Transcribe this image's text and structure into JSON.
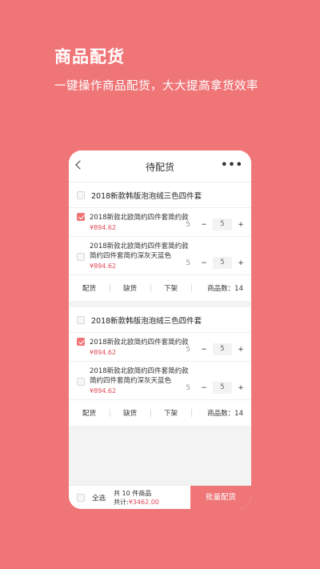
{
  "promo": {
    "title": "商品配货",
    "subtitle": "一键操作商品配货，大大提高拿货效率"
  },
  "nav": {
    "title": "待配货",
    "more": "•••"
  },
  "groups": [
    {
      "title": "2018新款韩版泡泡绒三色四件套",
      "items": [
        {
          "name": "2018新款北欧简约四件套简约款",
          "price": "¥894.62",
          "stock": "5",
          "qty": "5",
          "checked": true
        },
        {
          "name": "2018新款北欧简约四件套简约款简约四件套简约深灰天蓝色",
          "price": "¥894.62",
          "stock": "5",
          "qty": "5",
          "checked": false
        }
      ],
      "actions": {
        "pick": "配货",
        "short": "缺货",
        "off": "下架",
        "count": "商品数：14"
      }
    },
    {
      "title": "2018新款韩版泡泡绒三色四件套",
      "items": [
        {
          "name": "2018新款北欧简约四件套简约款",
          "price": "¥894.62",
          "stock": "5",
          "qty": "5",
          "checked": true
        },
        {
          "name": "2018新款北欧简约四件套简约款简约四件套简约深灰天蓝色",
          "price": "¥894.62",
          "stock": "5",
          "qty": "5",
          "checked": false
        }
      ],
      "actions": {
        "pick": "配货",
        "short": "缺货",
        "off": "下架",
        "count": "商品数：14"
      }
    }
  ],
  "controls": {
    "minus": "−",
    "plus": "+"
  },
  "bottom": {
    "select_all": "全选",
    "total_count": "共 10 件商品",
    "total_label": "共计:",
    "total_price": "¥3462.00",
    "batch": "批量配货"
  },
  "colors": {
    "accent": "#ef7577",
    "price": "#e04a57"
  }
}
